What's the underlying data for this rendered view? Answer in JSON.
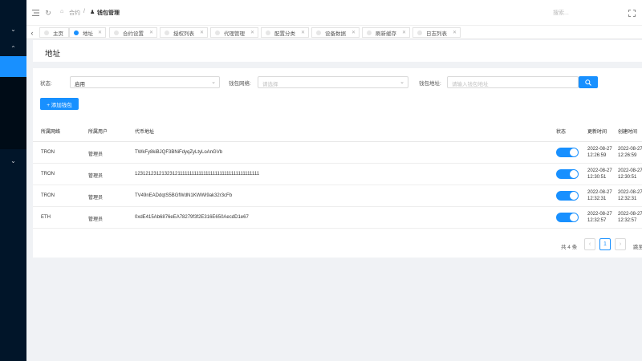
{
  "header": {
    "breadcrumb": [
      "合约",
      "钱包管理"
    ],
    "search_placeholder": "搜索..."
  },
  "tabs": [
    {
      "label": "主页",
      "active": false
    },
    {
      "label": "地址",
      "active": true
    },
    {
      "label": "合约设置",
      "active": false
    },
    {
      "label": "授权列表",
      "active": false
    },
    {
      "label": "代理管理",
      "active": false
    },
    {
      "label": "配置分类",
      "active": false
    },
    {
      "label": "设备数据",
      "active": false
    },
    {
      "label": "刷新缓存",
      "active": false
    },
    {
      "label": "日志列表",
      "active": false
    }
  ],
  "page": {
    "title": "地址"
  },
  "filters": {
    "status_label": "状态:",
    "status_value": "启用",
    "network_label": "钱包网络:",
    "network_placeholder": "请选择",
    "address_label": "钱包地址:",
    "address_placeholder": "请输入钱包地址"
  },
  "add_button": "+ 添加钱包",
  "table": {
    "columns": [
      "所属网络",
      "所属用户",
      "代币地址",
      "状态",
      "更新时间",
      "创建时间"
    ],
    "rows": [
      {
        "network": "TRON",
        "user": "管理员",
        "address": "TWkFy8kiBJQF3BNiFdyqZyLtyLoAnGVb",
        "status": "on",
        "updated": [
          "2022-08-27",
          "12:26:59"
        ],
        "created": [
          "2022-08-27",
          "12:26:59"
        ]
      },
      {
        "network": "TRON",
        "user": "管理员",
        "address": "123121231213231211111111111111111111111111111111111",
        "status": "on",
        "updated": [
          "2022-08-27",
          "12:30:51"
        ],
        "created": [
          "2022-08-27",
          "12:30:51"
        ]
      },
      {
        "network": "TRON",
        "user": "管理员",
        "address": "TV49nEADdqtS5BGfWdN1KWWi9ak32r3cFb",
        "status": "on",
        "updated": [
          "2022-08-27",
          "12:32:31"
        ],
        "created": [
          "2022-08-27",
          "12:32:31"
        ]
      },
      {
        "network": "ETH",
        "user": "管理员",
        "address": "0xdE415Ab6876eEA78279f3f2E316E650AecdD1e67",
        "status": "on",
        "updated": [
          "2022-08-27",
          "12:32:57"
        ],
        "created": [
          "2022-08-27",
          "12:32:57"
        ]
      }
    ]
  },
  "pagination": {
    "total_text": "共 4 条",
    "current_page": "1",
    "prev": "‹",
    "next": "›",
    "jump_label": "跳至"
  },
  "icons": {
    "menu": "menu-icon",
    "refresh": "refresh-icon",
    "fullscreen": "fullscreen-icon",
    "search": "search-icon"
  },
  "colors": {
    "sidebar": "#011529",
    "accent": "#1890ff"
  }
}
